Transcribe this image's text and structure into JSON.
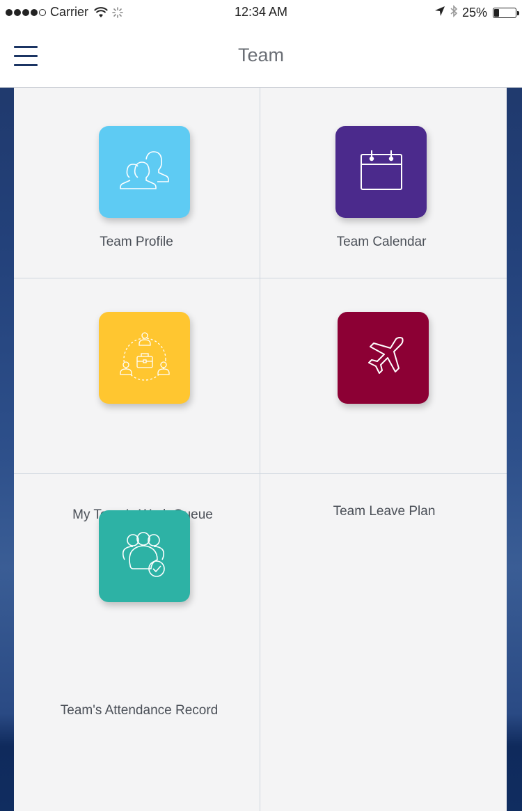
{
  "status_bar": {
    "carrier": "Carrier",
    "time": "12:34 AM",
    "battery": "25%",
    "battery_level": 0.25,
    "icons": [
      "signal-dots",
      "wifi-icon",
      "activity-spinner-icon",
      "location-arrow-icon",
      "bluetooth-icon",
      "battery-icon"
    ]
  },
  "nav": {
    "title": "Team",
    "menu_icon": "hamburger-menu-icon"
  },
  "tiles": [
    {
      "label": "Team Profile",
      "icon": "team-profile-icon",
      "color": "#5ecbf3"
    },
    {
      "label": "Team Calendar",
      "icon": "calendar-icon",
      "color": "#4b2a8c"
    },
    {
      "label": "My Team’s Work Queue",
      "icon": "work-queue-icon",
      "color": "#ffc630"
    },
    {
      "label": "Team Leave Plan",
      "icon": "airplane-icon",
      "color": "#8c0034"
    },
    {
      "label": "Team's Attendance Record",
      "icon": "attendance-icon",
      "color": "#2db2a5"
    }
  ],
  "colors": {
    "nav_accent": "#1b3463",
    "grid_background": "#f4f4f5",
    "divider": "#cfd6df"
  }
}
